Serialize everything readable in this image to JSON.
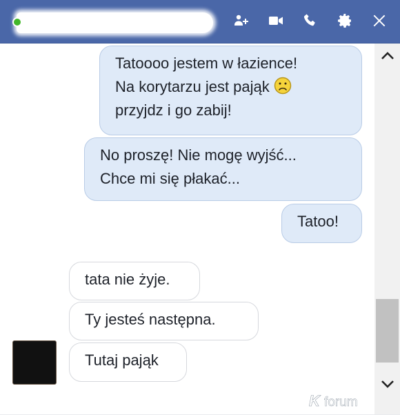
{
  "header": {
    "icons": [
      "add-friend-icon",
      "video-call-icon",
      "phone-icon",
      "gear-icon",
      "close-icon"
    ]
  },
  "messages": {
    "outgoing": [
      {
        "lines": [
          "Tatoooo jestem w łazience!",
          "Na korytarzu jest pająk",
          "przyjdz i go zabij!"
        ],
        "emoji": "sad-face-icon"
      },
      {
        "lines": [
          "No proszę! Nie mogę wyjść...",
          "Chce mi się płakać..."
        ]
      },
      {
        "lines": [
          "Tatoo!"
        ]
      }
    ],
    "incoming": [
      {
        "text": "tata nie żyje."
      },
      {
        "text": "Ty jesteś następna."
      },
      {
        "text": "Tutaj pająk"
      }
    ]
  },
  "watermark": "forum",
  "colors": {
    "header_bg": "#4a67a8",
    "outgoing_bubble": "#dfeaf8",
    "incoming_bubble": "#ffffff",
    "presence": "#42b72a"
  }
}
